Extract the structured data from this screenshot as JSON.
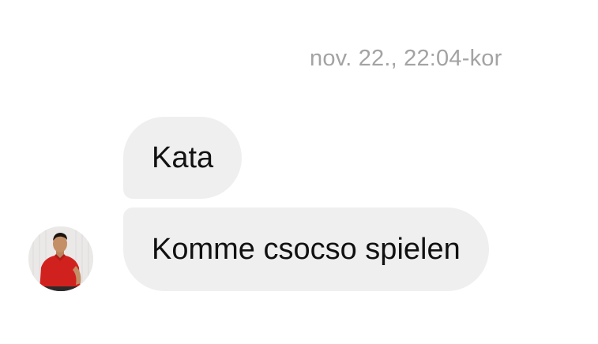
{
  "conversation": {
    "timestamp": "nov. 22., 22:04-kor",
    "messages": [
      {
        "text": "Kata"
      },
      {
        "text": "Komme csocso spielen"
      }
    ],
    "sender": {
      "avatar_icon": "profile-photo-avatar",
      "shirt_color": "#d1211e"
    },
    "bubble_color": "#efefef",
    "timestamp_color": "#a3a3a3"
  }
}
